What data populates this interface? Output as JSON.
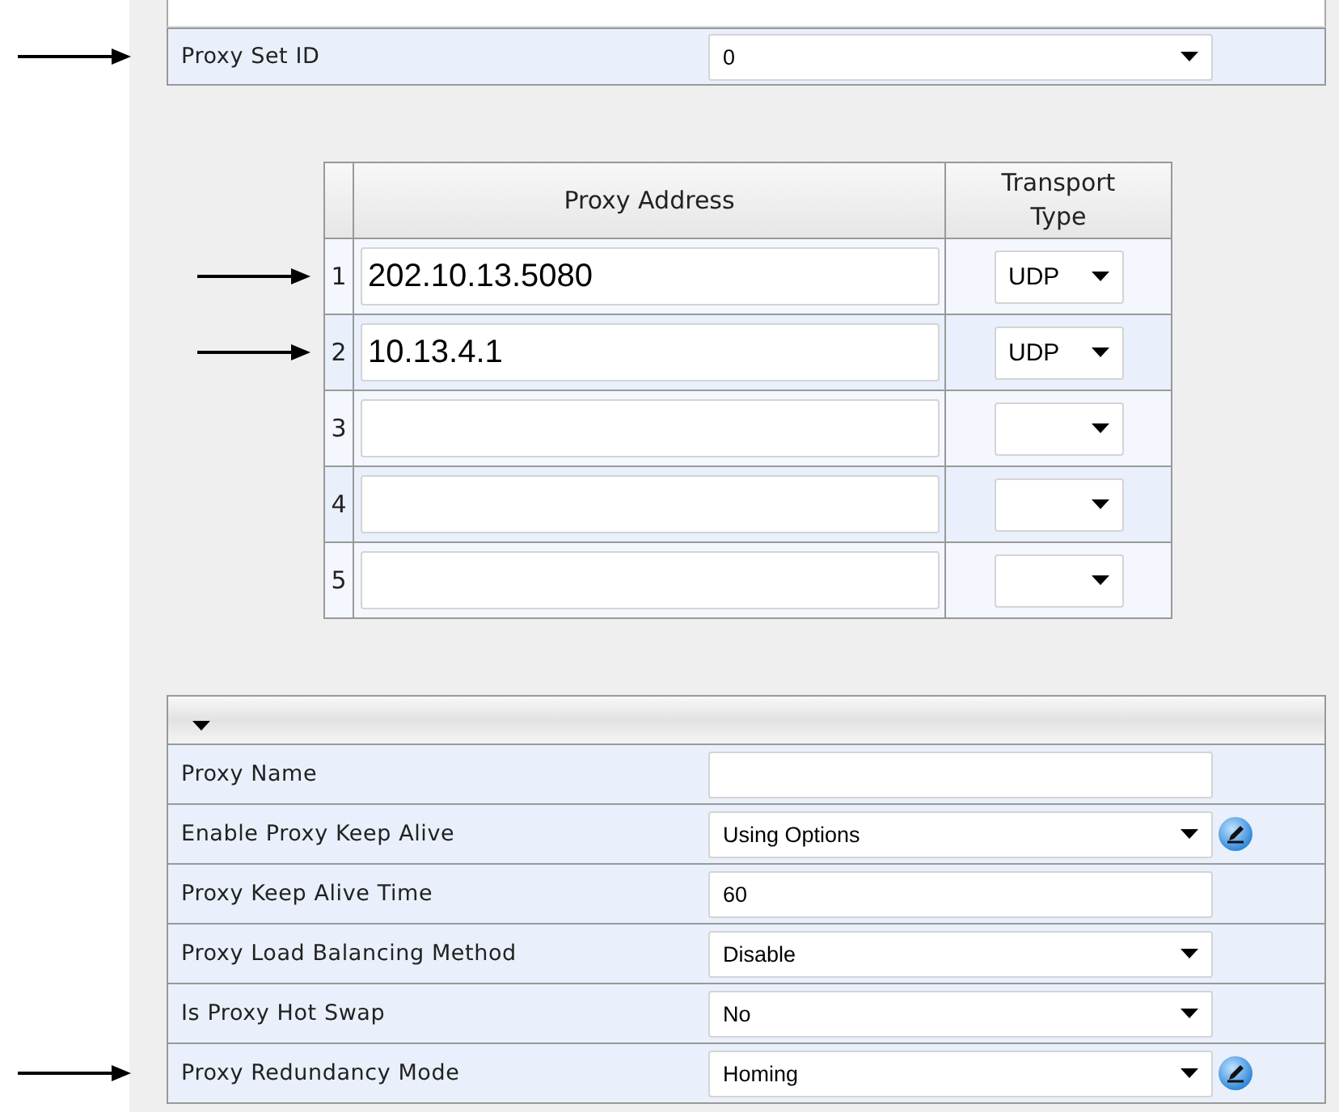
{
  "proxy_set": {
    "label": "Proxy Set ID",
    "value": "0",
    "arrow": true
  },
  "proxy_table": {
    "columns": [
      "Proxy Address",
      "Transport Type"
    ],
    "rows": [
      {
        "index": "1",
        "address": "202.10.13.5080",
        "transport": "UDP",
        "arrow": true
      },
      {
        "index": "2",
        "address": "10.13.4.1",
        "transport": "UDP",
        "arrow": true
      },
      {
        "index": "3",
        "arrow": false
      },
      {
        "index": "4",
        "arrow": false
      },
      {
        "index": "5",
        "arrow": false
      }
    ]
  },
  "settings": {
    "expanded": true,
    "rows": [
      {
        "label": "Proxy Name",
        "kind": "text",
        "arrow": false,
        "edit": false
      },
      {
        "label": "Enable Proxy Keep Alive",
        "kind": "select",
        "value": "Using Options",
        "arrow": false,
        "edit": true
      },
      {
        "label": "Proxy Keep Alive Time",
        "kind": "text",
        "value": "60",
        "arrow": false,
        "edit": false
      },
      {
        "label": "Proxy Load Balancing Method",
        "kind": "select",
        "value": "Disable",
        "arrow": false,
        "edit": false
      },
      {
        "label": "Is Proxy Hot Swap",
        "kind": "select",
        "value": "No",
        "arrow": false,
        "edit": false
      },
      {
        "label": "Proxy Redundancy Mode",
        "kind": "select",
        "value": "Homing",
        "arrow": true,
        "edit": true
      }
    ]
  }
}
